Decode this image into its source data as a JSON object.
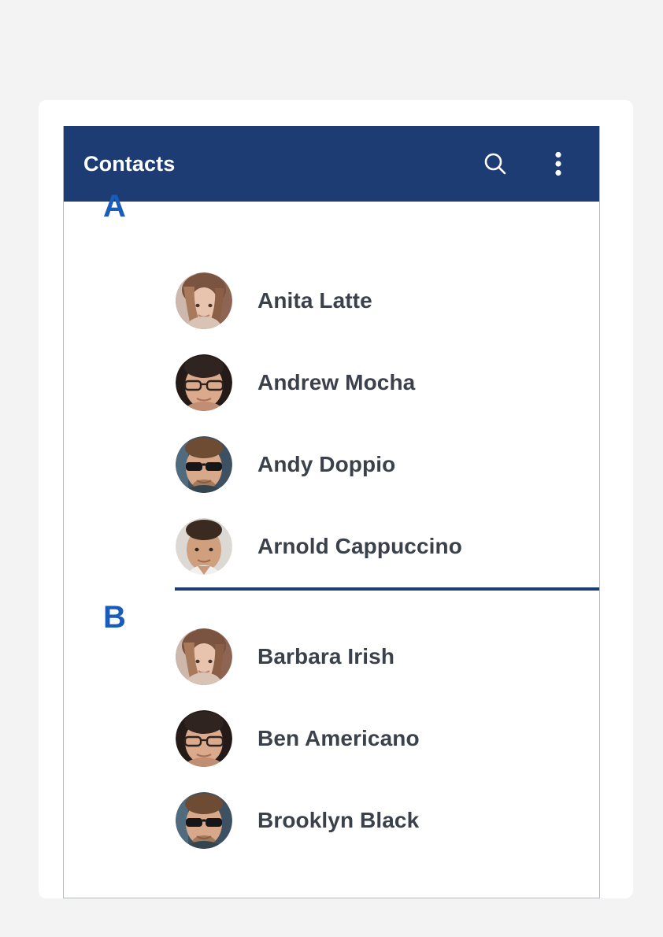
{
  "app": {
    "title": "Contacts",
    "header_bg": "#1d3c74",
    "header_text_color": "#ffffff",
    "accent_letter_color": "#1a5cba",
    "divider_color": "#1d3c74",
    "name_color": "#3b414b",
    "page_bg": "#f3f3f3",
    "card_bg": "#ffffff"
  },
  "actions": [
    {
      "name": "search-icon",
      "label": "Search"
    },
    {
      "name": "overflow-menu-icon",
      "label": "More options"
    }
  ],
  "sections": [
    {
      "letter": "A",
      "has_divider": false,
      "contacts": [
        {
          "name": "Anita Latte",
          "avatar": "woman-brown-hair"
        },
        {
          "name": "Andrew Mocha",
          "avatar": "man-glasses"
        },
        {
          "name": "Andy Doppio",
          "avatar": "man-sunglasses"
        },
        {
          "name": "Arnold Cappuccino",
          "avatar": "man-dark-hair"
        }
      ]
    },
    {
      "letter": "B",
      "has_divider": true,
      "contacts": [
        {
          "name": "Barbara Irish",
          "avatar": "woman-brown-hair"
        },
        {
          "name": "Ben Americano",
          "avatar": "man-glasses"
        },
        {
          "name": "Brooklyn Black",
          "avatar": "man-sunglasses"
        }
      ]
    }
  ]
}
